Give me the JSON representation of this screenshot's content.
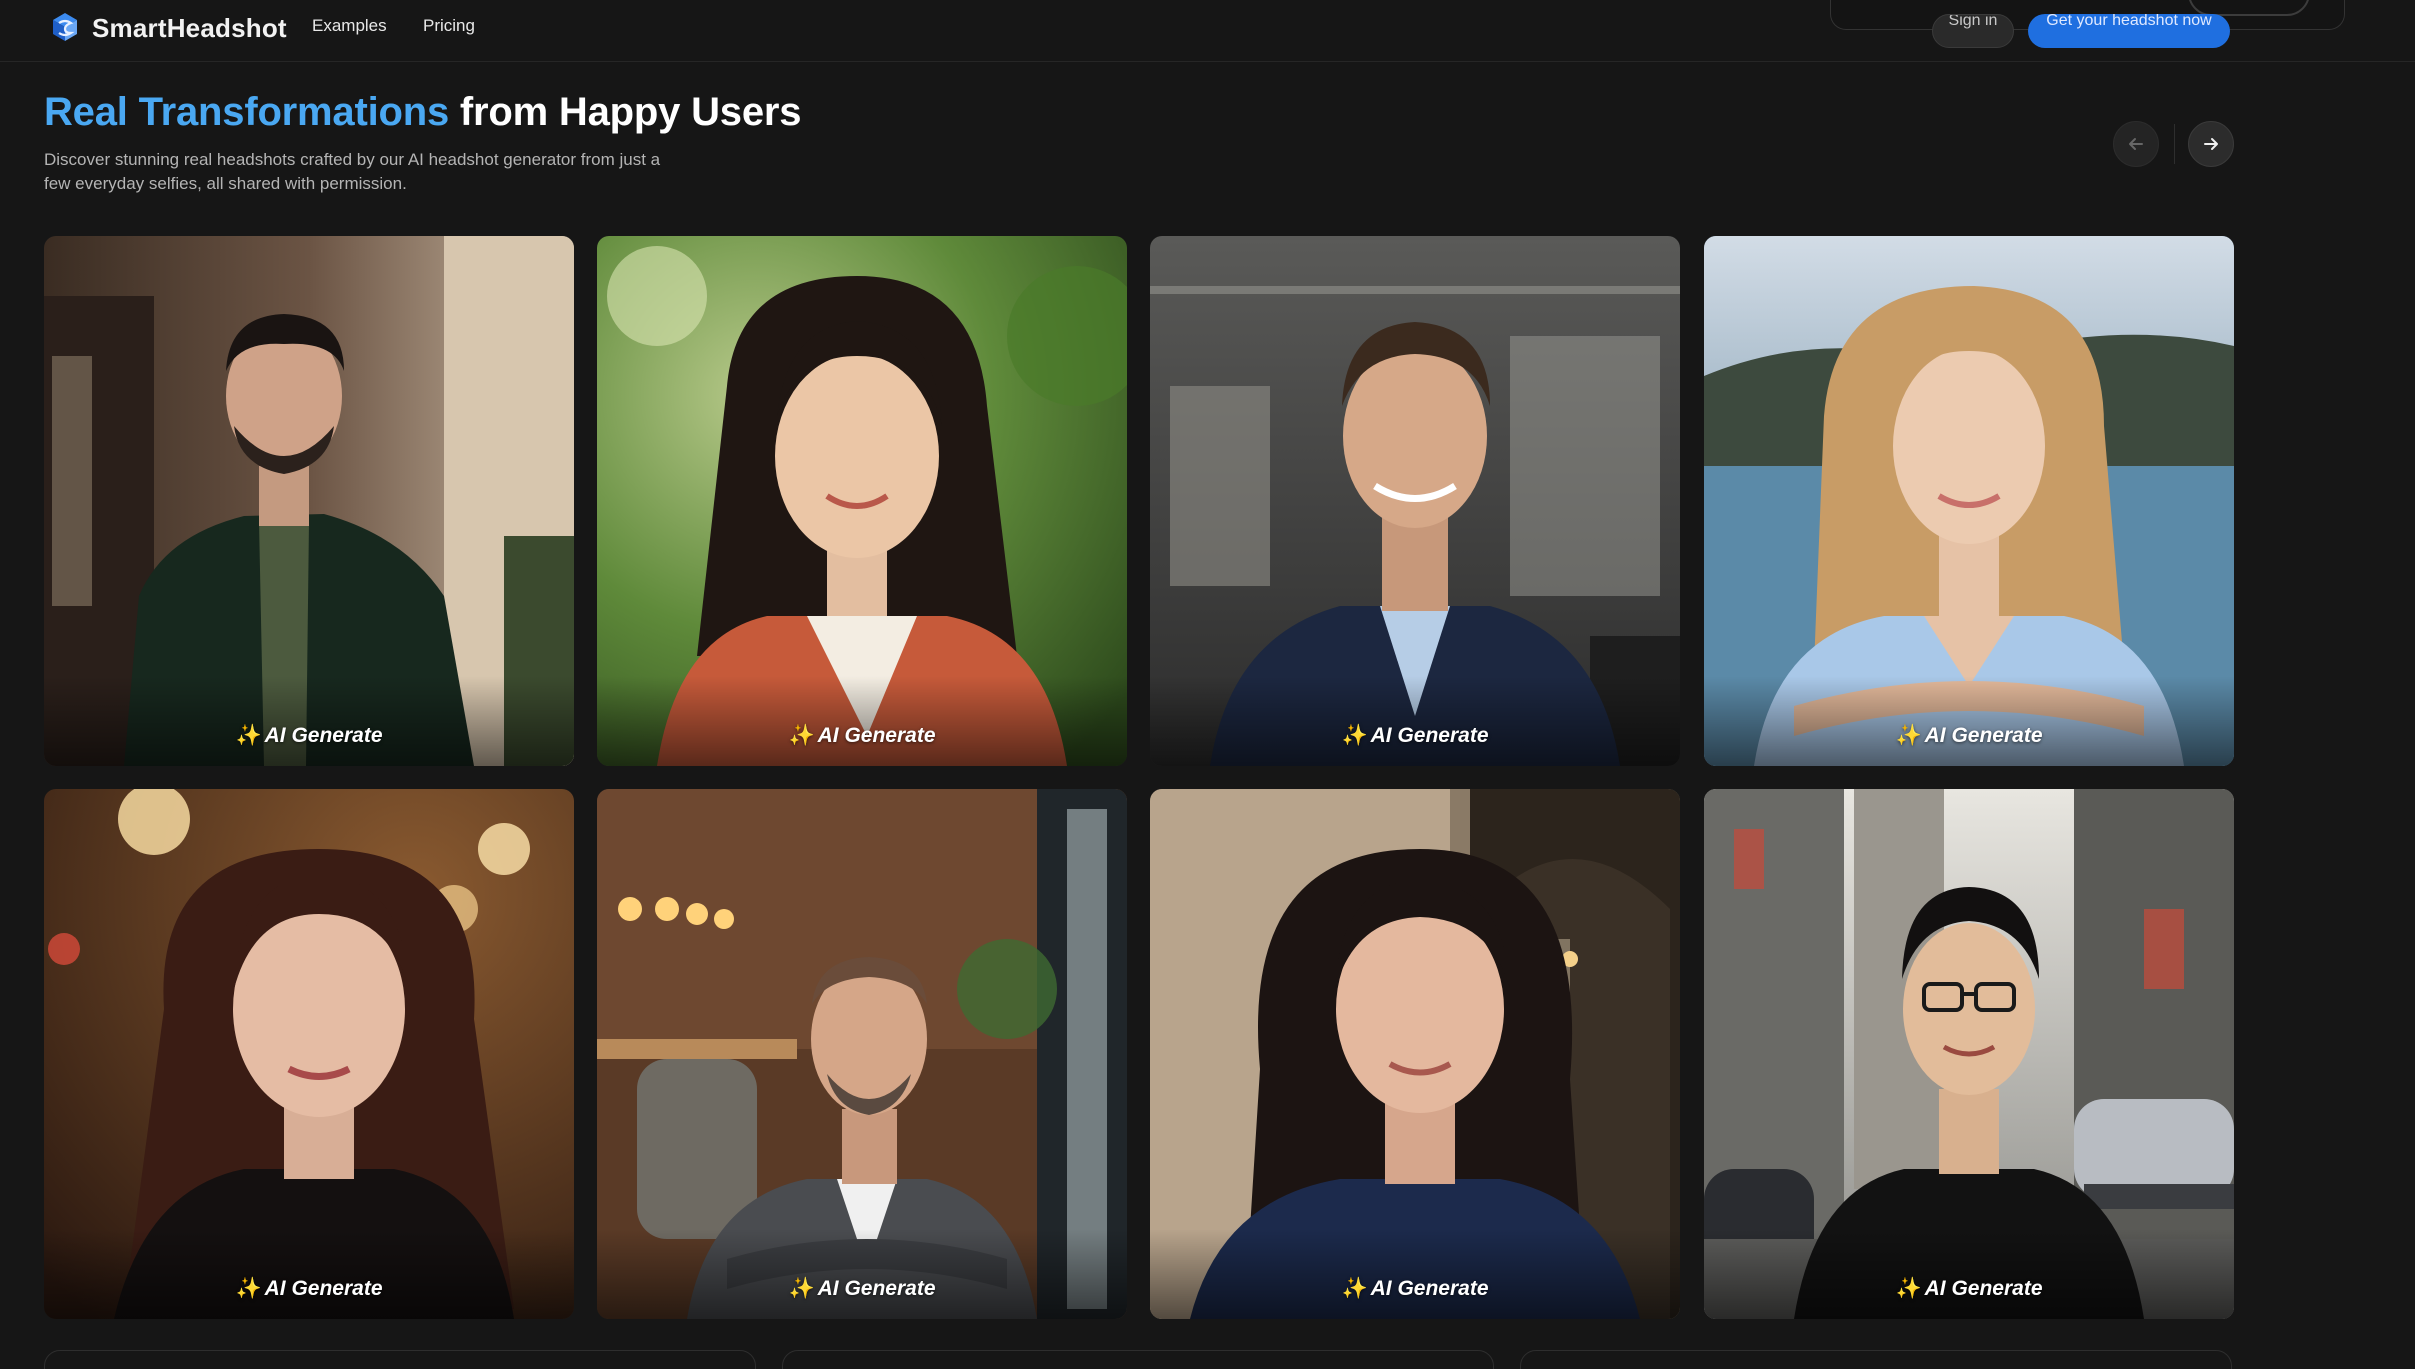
{
  "header": {
    "brand_name": "SmartHeadshot",
    "nav": [
      {
        "label": "Examples"
      },
      {
        "label": "Pricing"
      }
    ],
    "signin_label": "Sign in",
    "cta_label": "Get your headshot now",
    "accent_color": "#1f6fe0"
  },
  "section": {
    "title_accent": "Real Transformations",
    "title_rest": " from Happy Users",
    "description": "Discover stunning real headshots crafted by our AI headshot generator from just a few everyday selfies, all shared with permission.",
    "prev_icon": "arrow-left-icon",
    "next_icon": "arrow-right-icon",
    "title_accent_color": "#4aa8f2"
  },
  "gallery": {
    "cards": [
      {
        "label": "AI Generate",
        "subject": "man in dark green blazer"
      },
      {
        "label": "AI Generate",
        "subject": "woman in orange blazer"
      },
      {
        "label": "AI Generate",
        "subject": "man in navy suit"
      },
      {
        "label": "AI Generate",
        "subject": "woman in light blue shirt"
      },
      {
        "label": "AI Generate",
        "subject": "woman in black turtleneck"
      },
      {
        "label": "AI Generate",
        "subject": "man in grey suit"
      },
      {
        "label": "AI Generate",
        "subject": "woman in navy sweater"
      },
      {
        "label": "AI Generate",
        "subject": "man in black jacket"
      }
    ],
    "sparkle_icon": "sparkle-icon"
  }
}
